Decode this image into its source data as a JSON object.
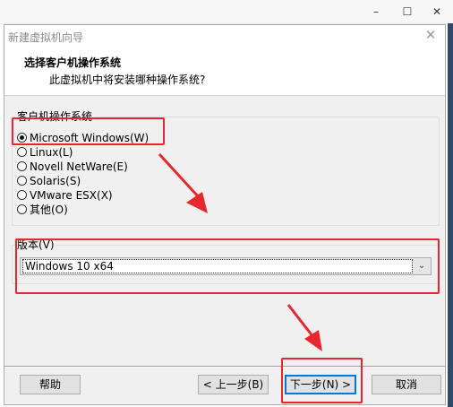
{
  "parent_window": {
    "minimize": "–",
    "maximize": "☐",
    "close": "✕"
  },
  "dialog": {
    "title": "新建虚拟机向导",
    "close_glyph": "✕",
    "heading": "选择客户机操作系统",
    "subheading": "此虚拟机中将安装哪种操作系统?"
  },
  "guest_os_group": {
    "label": "客户机操作系统",
    "options": [
      {
        "label": "Microsoft Windows(W)",
        "checked": true
      },
      {
        "label": "Linux(L)",
        "checked": false
      },
      {
        "label": "Novell NetWare(E)",
        "checked": false
      },
      {
        "label": "Solaris(S)",
        "checked": false
      },
      {
        "label": "VMware ESX(X)",
        "checked": false
      },
      {
        "label": "其他(O)",
        "checked": false
      }
    ]
  },
  "version_group": {
    "label": "版本(V)",
    "selected": "Windows 10 x64"
  },
  "buttons": {
    "help": "帮助",
    "back": "< 上一步(B)",
    "next": "下一步(N) >",
    "cancel": "取消"
  },
  "colors": {
    "annotation": "#e8262d",
    "dialog_bg": "#f0f0f0",
    "focus_blue": "#0078d7"
  },
  "icons": {
    "dropdown": "chevron-down-icon",
    "close": "close-icon"
  }
}
